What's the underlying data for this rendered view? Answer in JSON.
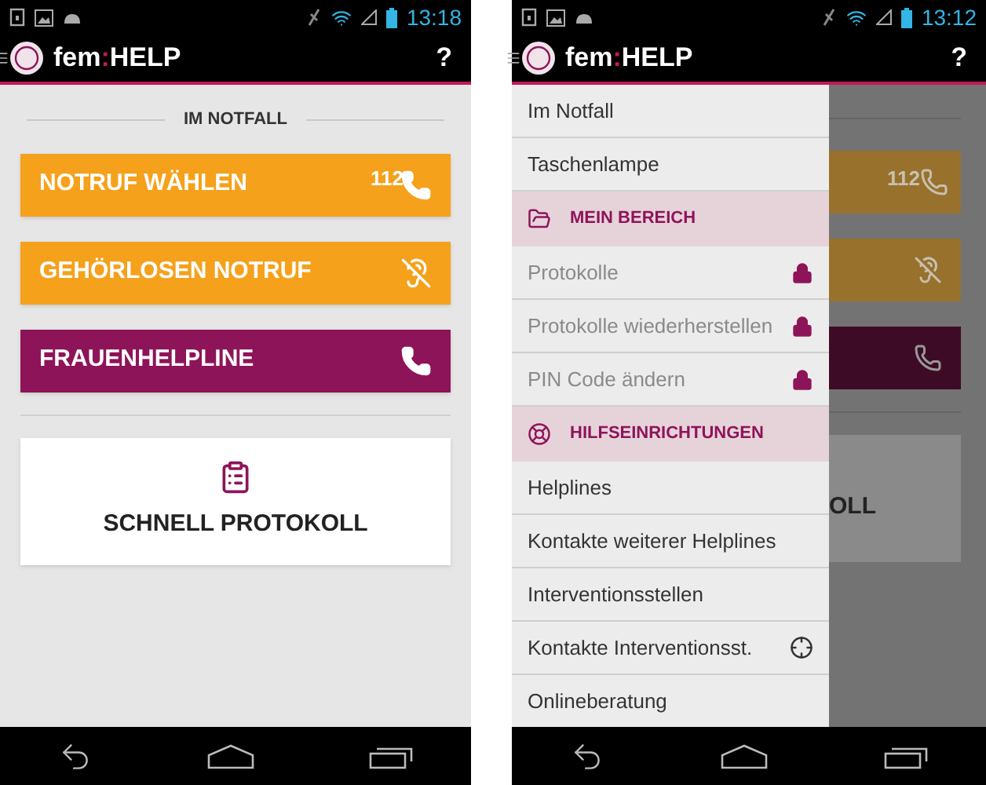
{
  "screens": [
    {
      "status_bar": {
        "time": "13:18"
      },
      "app_bar": {
        "brand": "fem",
        "separator": ":",
        "brand_suffix": "HELP",
        "help": "?"
      },
      "content": {
        "section_title": "IM NOTFALL",
        "buttons": [
          {
            "kind": "call",
            "label": "NOTRUF WÄHLEN",
            "badge": "112",
            "color": "#f5a11c"
          },
          {
            "kind": "deaf",
            "label": "GEHÖRLOSEN NOTRUF",
            "color": "#f5a11c"
          },
          {
            "kind": "call",
            "label": "FRAUENHELPLINE",
            "color": "#8e1459"
          }
        ],
        "card": {
          "label": "SCHNELL PROTOKOLL"
        }
      }
    },
    {
      "status_bar": {
        "time": "13:12"
      },
      "app_bar": {
        "brand": "fem",
        "separator": ":",
        "brand_suffix": "HELP",
        "help": "?"
      },
      "drawer": {
        "items": [
          {
            "kind": "item",
            "label": "Im Notfall",
            "locked": false
          },
          {
            "kind": "item",
            "label": "Taschenlampe",
            "locked": false
          },
          {
            "kind": "header",
            "label": "MEIN BEREICH"
          },
          {
            "kind": "item",
            "label": "Protokolle",
            "locked": true
          },
          {
            "kind": "item",
            "label": "Protokolle wiederherstellen",
            "locked": true
          },
          {
            "kind": "item",
            "label": "PIN Code ändern",
            "locked": true
          },
          {
            "kind": "header",
            "label": "HILFSEINRICHTUNGEN"
          },
          {
            "kind": "item",
            "label": "Helplines",
            "locked": false
          },
          {
            "kind": "item",
            "label": "Kontakte weiterer Helplines",
            "locked": false
          },
          {
            "kind": "item",
            "label": "Interventionsstellen",
            "locked": false
          },
          {
            "kind": "item",
            "label": "Kontakte Interventionsst.",
            "locked": false,
            "locate": true
          },
          {
            "kind": "item",
            "label": "Onlineberatung",
            "locked": false
          }
        ]
      },
      "dimmed_content": {
        "badge": "112",
        "card_text": "OLL"
      }
    }
  ]
}
